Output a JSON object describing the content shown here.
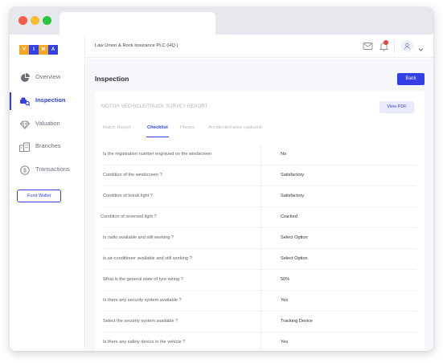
{
  "logo": {
    "letters": [
      "V",
      "I",
      "M",
      "A"
    ],
    "colors": [
      "#f2a623",
      "#3340e5",
      "#f2a623",
      "#3340e5"
    ]
  },
  "sidebar": {
    "items": [
      {
        "label": "Overview",
        "icon": "pie-chart-icon",
        "active": false
      },
      {
        "label": "Inspection",
        "icon": "car-search-icon",
        "active": true
      },
      {
        "label": "Valuation",
        "icon": "diamond-icon",
        "active": false
      },
      {
        "label": "Branches",
        "icon": "buildings-icon",
        "active": false
      },
      {
        "label": "Transactions",
        "icon": "dollar-coin-icon",
        "active": false
      }
    ],
    "fund_wallet_label": "Fund Wallet"
  },
  "topbar": {
    "company": "Law Union & Rock Insurance PLC (HQ )",
    "icons": [
      "mail-icon",
      "bell-icon",
      "user-avatar-icon",
      "chevron-down-icon"
    ]
  },
  "page": {
    "title": "Inspection",
    "back_label": "Back"
  },
  "report": {
    "title": "MOTOR VECHICLE/TRUCK SURVEY REPORT",
    "view_pdf_label": "View PDF",
    "tabs": [
      "Match Report",
      "Checklist",
      "Photos",
      "Accidented area captured"
    ],
    "active_tab": "Checklist",
    "rows": [
      {
        "q": "Is the registration number engraved on the windscreen",
        "a": "No"
      },
      {
        "q": "Condition of the windscreen ?",
        "a": "Satisfactory"
      },
      {
        "q": "Condition of break light ?",
        "a": "Satisfactory"
      },
      {
        "q": "Condition of reversed light ?",
        "a": "Cracked"
      },
      {
        "q": "Is radio available and still working ?",
        "a": "Select Option"
      },
      {
        "q": "is air-conditioner available and still working ?",
        "a": "Select Option"
      },
      {
        "q": "What is the general state of tyre wiring ?",
        "a": "50%"
      },
      {
        "q": "Is there any security system available ?",
        "a": "Yes"
      },
      {
        "q": "Select the security system available ?",
        "a": "Tracking Device"
      },
      {
        "q": "Is there any safety device in the vehicle ?",
        "a": "Yes"
      }
    ]
  },
  "colors": {
    "accent": "#3340e5",
    "notification": "#e8423d",
    "logo_orange": "#f2a623"
  }
}
